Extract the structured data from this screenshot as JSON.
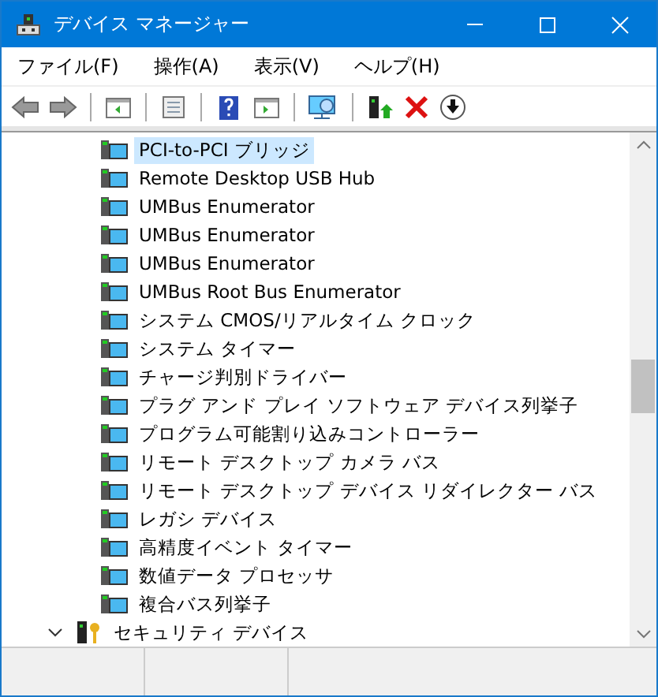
{
  "window": {
    "title": "デバイス マネージャー"
  },
  "menu": [
    {
      "label": "ファイル(F)"
    },
    {
      "label": "操作(A)"
    },
    {
      "label": "表示(V)"
    },
    {
      "label": "ヘルプ(H)"
    }
  ],
  "devices": [
    {
      "label": "PCI-to-PCI ブリッジ",
      "selected": true
    },
    {
      "label": "Remote Desktop USB Hub",
      "selected": false
    },
    {
      "label": "UMBus Enumerator",
      "selected": false
    },
    {
      "label": "UMBus Enumerator",
      "selected": false
    },
    {
      "label": "UMBus Enumerator",
      "selected": false
    },
    {
      "label": "UMBus Root Bus Enumerator",
      "selected": false
    },
    {
      "label": "システム CMOS/リアルタイム クロック",
      "selected": false
    },
    {
      "label": "システム タイマー",
      "selected": false
    },
    {
      "label": "チャージ判別ドライバー",
      "selected": false
    },
    {
      "label": "プラグ アンド プレイ ソフトウェア デバイス列挙子",
      "selected": false
    },
    {
      "label": "プログラム可能割り込みコントローラー",
      "selected": false
    },
    {
      "label": "リモート デスクトップ カメラ バス",
      "selected": false
    },
    {
      "label": "リモート デスクトップ デバイス リダイレクター バス",
      "selected": false
    },
    {
      "label": "レガシ デバイス",
      "selected": false
    },
    {
      "label": "高精度イベント タイマー",
      "selected": false
    },
    {
      "label": "数値データ プロセッサ",
      "selected": false
    },
    {
      "label": "複合バス列挙子",
      "selected": false
    }
  ],
  "category": {
    "label": "セキュリティ デバイス",
    "expanded": true
  }
}
